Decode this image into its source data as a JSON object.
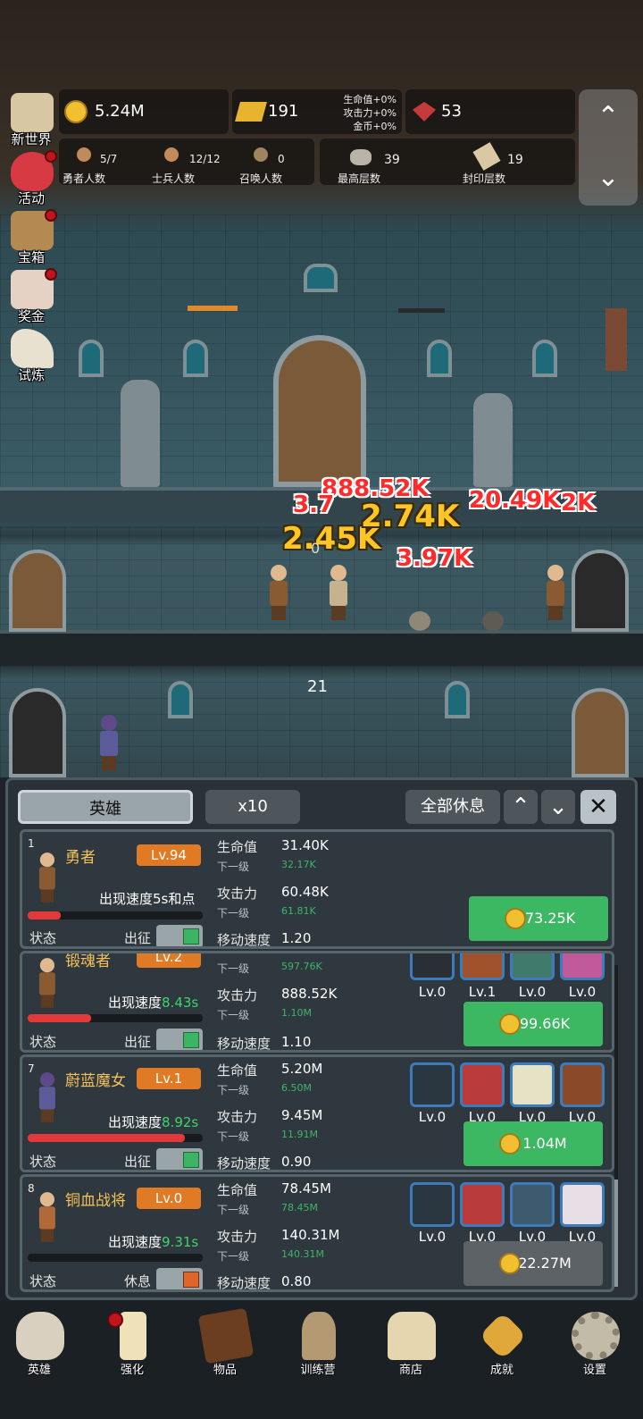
{
  "resources": {
    "gold": "5.24M",
    "gold_bar": "191",
    "gem": "53",
    "bonus": [
      "生命值+0%",
      "攻击力+0%",
      "金币+0%"
    ]
  },
  "counts": [
    {
      "value": "5/7",
      "label": "勇者人数"
    },
    {
      "value": "12/12",
      "label": "士兵人数"
    },
    {
      "value": "0",
      "label": "召唤人数"
    },
    {
      "value": "39",
      "label": "最高层数"
    },
    {
      "value": "19",
      "label": "封印层数"
    }
  ],
  "side_menu": [
    {
      "label": "新世界",
      "icon": "map-icon",
      "badge": false
    },
    {
      "label": "活动",
      "icon": "heart-icon",
      "badge": true
    },
    {
      "label": "宝箱",
      "icon": "chest-icon",
      "badge": true
    },
    {
      "label": "奖金",
      "icon": "envelope-icon",
      "badge": true
    },
    {
      "label": "试炼",
      "icon": "wing-icon",
      "badge": false
    }
  ],
  "scene": {
    "floor_number": "21",
    "zero_label": "0",
    "damage": [
      {
        "t": "888.52K",
        "c": "red"
      },
      {
        "t": "3.7",
        "c": "red"
      },
      {
        "t": "2.45K",
        "c": "yellow"
      },
      {
        "t": "2.74K",
        "c": "yellow"
      },
      {
        "t": "20.49K",
        "c": "red"
      },
      {
        "t": "2K",
        "c": "red"
      },
      {
        "t": "3.97K",
        "c": "red"
      }
    ]
  },
  "panel": {
    "tab": "英雄",
    "multiplier": "x10",
    "rest_all": "全部休息",
    "heroes": [
      {
        "index": "1",
        "name": "勇者",
        "level": "Lv.94",
        "speed_label": "出现速度",
        "speed": "5s和点",
        "hp_ratio": 0.19,
        "hp_label": "生命值",
        "hp": "31.40K",
        "hp_next_label": "下一级",
        "hp_next": "32.17K",
        "atk_label": "攻击力",
        "atk": "60.48K",
        "atk_next_label": "下一级",
        "atk_next": "61.81K",
        "move_label": "移动速度",
        "move": "1.20",
        "status": "状态",
        "deploy": "出征",
        "active": true,
        "cost": "73.25K",
        "equip": []
      },
      {
        "index": "",
        "name": "锻魂者",
        "level": "Lv.2",
        "speed_label": "出现速度",
        "speed": "8.43s",
        "hp_ratio": 0.36,
        "hp_label": "",
        "hp": "",
        "hp_next_label": "下一级",
        "hp_next": "597.76K",
        "atk_label": "攻击力",
        "atk": "888.52K",
        "atk_next_label": "下一级",
        "atk_next": "1.10M",
        "move_label": "移动速度",
        "move": "1.10",
        "status": "状态",
        "deploy": "出征",
        "active": true,
        "cost": "99.66K",
        "equip": [
          "Lv.0",
          "Lv.1",
          "Lv.0",
          "Lv.0"
        ]
      },
      {
        "index": "7",
        "name": "蔚蓝魔女",
        "level": "Lv.1",
        "speed_label": "出现速度",
        "speed": "8.92s",
        "hp_ratio": 0.9,
        "hp_label": "生命值",
        "hp": "5.20M",
        "hp_next_label": "下一级",
        "hp_next": "6.50M",
        "atk_label": "攻击力",
        "atk": "9.45M",
        "atk_next_label": "下一级",
        "atk_next": "11.91M",
        "move_label": "移动速度",
        "move": "0.90",
        "status": "状态",
        "deploy": "出征",
        "active": true,
        "cost": "1.04M",
        "equip": [
          "Lv.0",
          "Lv.0",
          "Lv.0",
          "Lv.0"
        ]
      },
      {
        "index": "8",
        "name": "铜血战将",
        "level": "Lv.0",
        "speed_label": "出现速度",
        "speed": "9.31s",
        "hp_ratio": 0.0,
        "hp_label": "生命值",
        "hp": "78.45M",
        "hp_next_label": "下一级",
        "hp_next": "78.45M",
        "atk_label": "攻击力",
        "atk": "140.31M",
        "atk_next_label": "下一级",
        "atk_next": "140.31M",
        "move_label": "移动速度",
        "move": "0.80",
        "status": "状态",
        "deploy": "休息",
        "active": false,
        "cost": "22.27M",
        "equip": [
          "Lv.0",
          "Lv.0",
          "Lv.0",
          "Lv.0"
        ]
      }
    ]
  },
  "nav": [
    {
      "label": "英雄",
      "icon": "skull-icon",
      "badge": false
    },
    {
      "label": "强化",
      "icon": "candle-icon",
      "badge": true
    },
    {
      "label": "物品",
      "icon": "book-icon",
      "badge": false
    },
    {
      "label": "训练营",
      "icon": "lantern-icon",
      "badge": false
    },
    {
      "label": "商店",
      "icon": "mug-icon",
      "badge": false
    },
    {
      "label": "成就",
      "icon": "key-icon",
      "badge": false
    },
    {
      "label": "设置",
      "icon": "gear-icon",
      "badge": false
    }
  ]
}
